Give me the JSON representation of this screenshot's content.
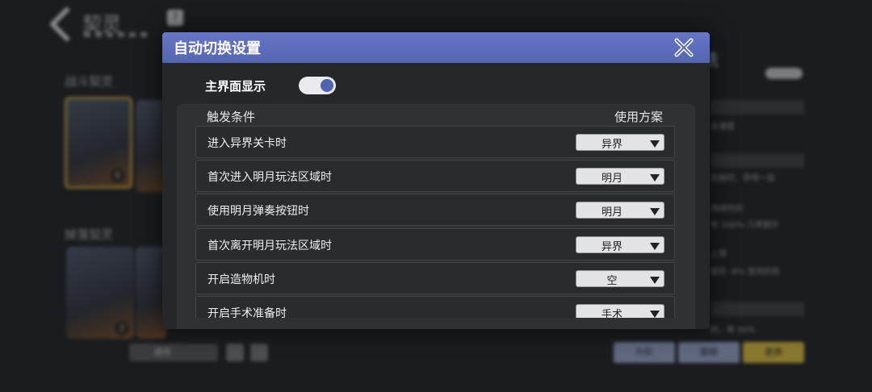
{
  "background": {
    "title": "契灵",
    "help_icon": "question-icon",
    "section_battle": "战斗契灵",
    "section_drop": "掉落契灵",
    "card_levels": [
      "6",
      "2"
    ],
    "dropdown_text": "通用",
    "right_title": "铣",
    "right_texts": [
      "击速度",
      "技能时，获得一层",
      "持续时间",
      "有 100% 几率额外",
      "上限",
      "额外 -8% 受到的伤",
      "时，有 50%"
    ],
    "buttons": [
      "升阶",
      "跟随",
      "更换"
    ]
  },
  "modal": {
    "title": "自动切换设置",
    "close_icon": "close-x-icon",
    "toggle": {
      "label": "主界面显示",
      "on": true
    },
    "table": {
      "header_condition": "触发条件",
      "header_scheme": "使用方案",
      "rows": [
        {
          "condition": "进入异界关卡时",
          "scheme": "异界"
        },
        {
          "condition": "首次进入明月玩法区域时",
          "scheme": "明月"
        },
        {
          "condition": "使用明月弹奏按钮时",
          "scheme": "明月"
        },
        {
          "condition": "首次离开明月玩法区域时",
          "scheme": "异界"
        },
        {
          "condition": "开启造物机时",
          "scheme": "空"
        },
        {
          "condition": "开启手术准备时",
          "scheme": "手术"
        }
      ]
    }
  },
  "colors": {
    "header": "#5a6ab8",
    "toggle_knob": "#4f63b0",
    "panel": "#262729"
  }
}
